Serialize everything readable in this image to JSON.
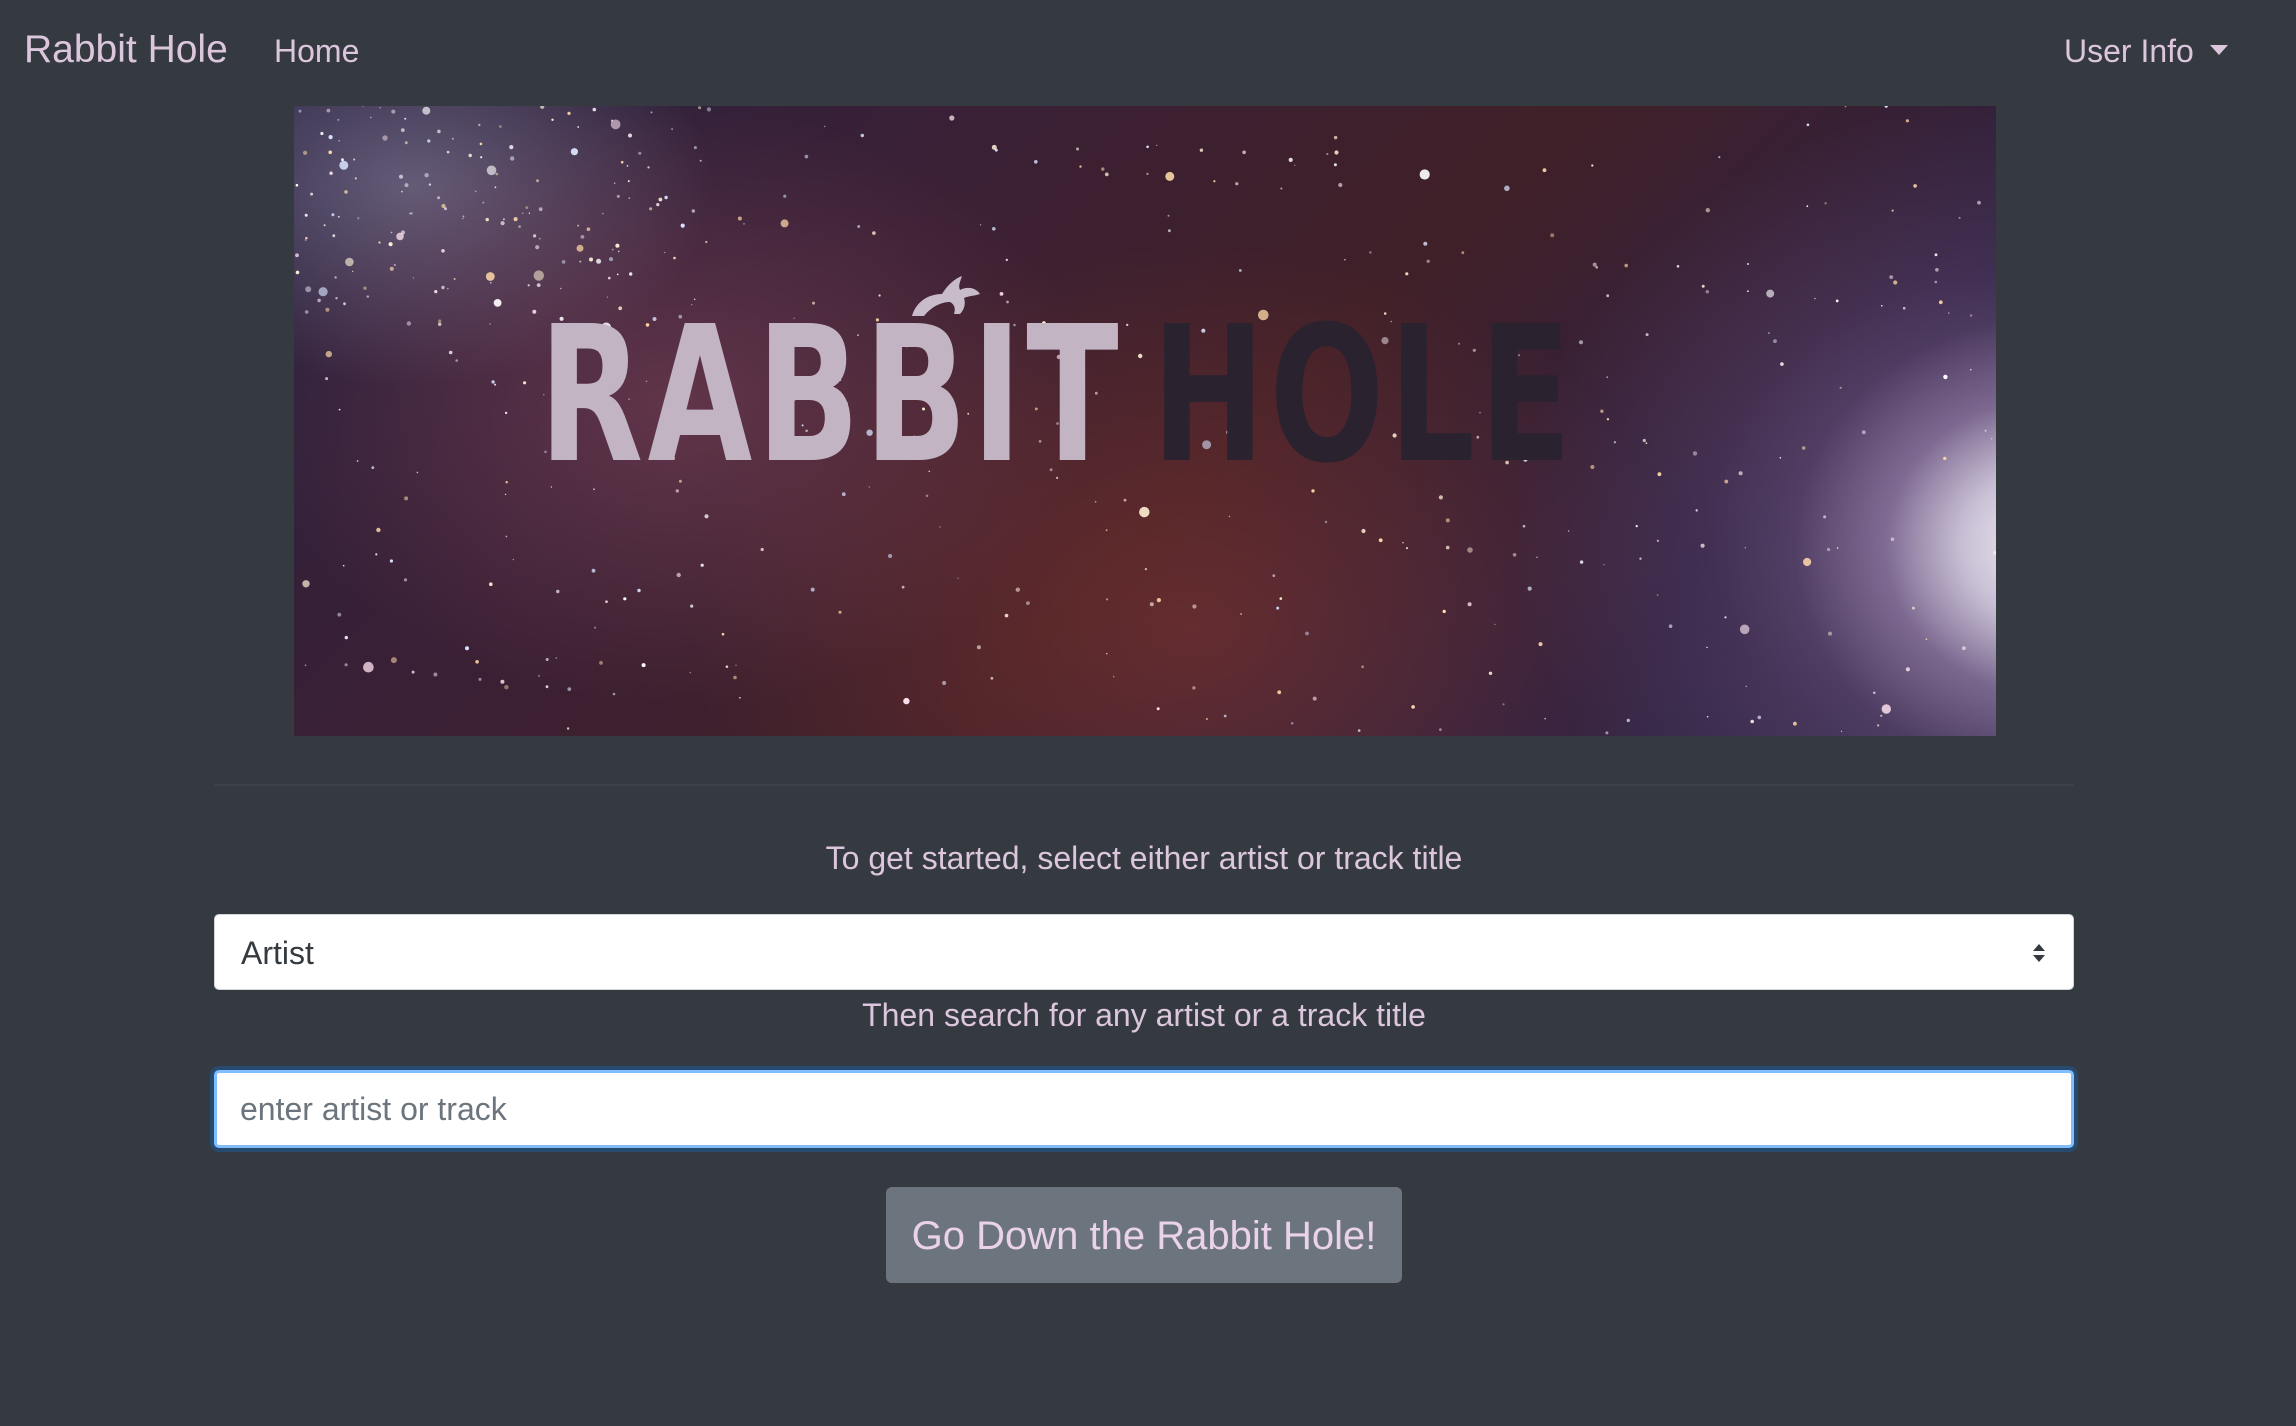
{
  "navbar": {
    "brand": "Rabbit Hole",
    "home": "Home",
    "user_info": "User Info"
  },
  "banner": {
    "title_word_1": "RABBIT",
    "title_word_2": "HOLE"
  },
  "form": {
    "instruction_1": "To get started, select either artist or track title",
    "select_value": "Artist",
    "instruction_2": "Then search for any artist or a track title",
    "search_placeholder": "enter artist or track",
    "submit_label": "Go Down the Rabbit Hole!"
  },
  "colors": {
    "page_background": "#343a40",
    "text_accent": "#dcc6dc",
    "button_background": "#6c757d",
    "focus_border": "#80bdff"
  }
}
